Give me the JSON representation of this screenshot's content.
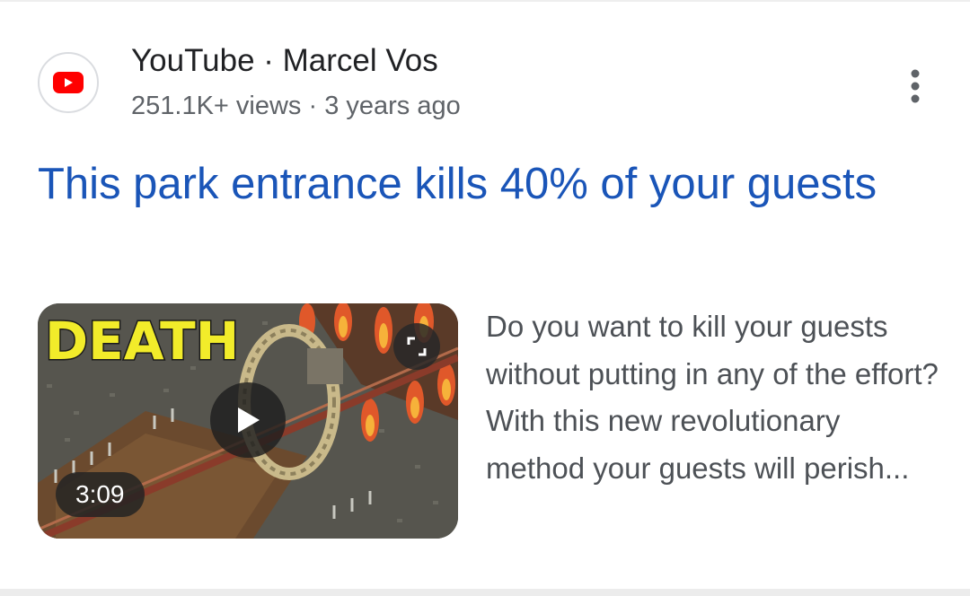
{
  "result": {
    "source": "YouTube · Marcel Vos",
    "meta": "251.1K+ views · 3 years ago",
    "title": "This park entrance kills 40% of your guests",
    "snippet": "Do you want to kill your guests without putting in any of the effort? With this new revolutionary method your guests will perish...",
    "thumbnail": {
      "overlay_text": "DEATH",
      "duration": "3:09"
    },
    "icons": {
      "source": "youtube-logo-icon",
      "more": "more-vert-icon",
      "expand": "expand-icon",
      "play": "play-icon"
    }
  },
  "colors": {
    "title_link": "#1a55b8",
    "youtube_red": "#ff0000",
    "source_text": "#202124",
    "meta_text": "#5f6368",
    "snippet_text": "#4d5156"
  }
}
